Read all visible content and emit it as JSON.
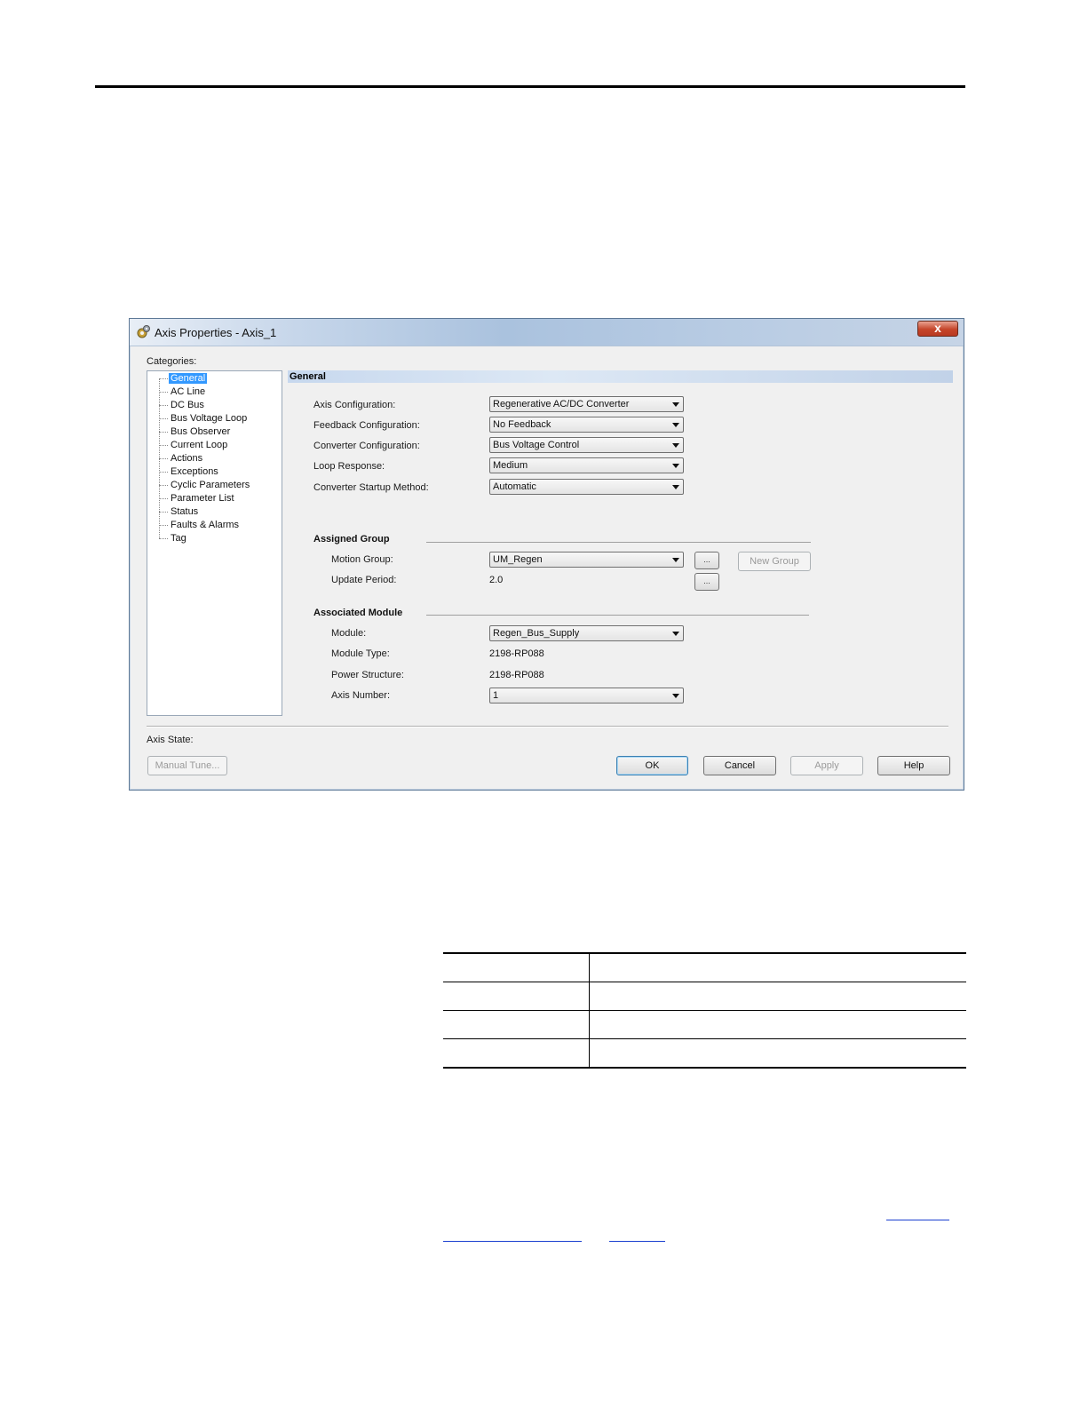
{
  "window": {
    "title": "Axis Properties - Axis_1",
    "close_label": "x"
  },
  "categories": {
    "label": "Categories:",
    "items": [
      {
        "label": "General",
        "selected": true
      },
      {
        "label": "AC Line"
      },
      {
        "label": "DC Bus"
      },
      {
        "label": "Bus Voltage Loop"
      },
      {
        "label": "Bus Observer"
      },
      {
        "label": "Current Loop"
      },
      {
        "label": "Actions"
      },
      {
        "label": "Exceptions"
      },
      {
        "label": "Cyclic Parameters"
      },
      {
        "label": "Parameter List"
      },
      {
        "label": "Status"
      },
      {
        "label": "Faults & Alarms"
      },
      {
        "label": "Tag"
      }
    ]
  },
  "general": {
    "header": "General",
    "axis_configuration": {
      "label": "Axis Configuration:",
      "value": "Regenerative AC/DC Converter"
    },
    "feedback_configuration": {
      "label": "Feedback Configuration:",
      "value": "No Feedback"
    },
    "converter_configuration": {
      "label": "Converter Configuration:",
      "value": "Bus Voltage Control"
    },
    "loop_response": {
      "label": "Loop Response:",
      "value": "Medium"
    },
    "converter_startup_method": {
      "label": "Converter Startup Method:",
      "value": "Automatic"
    }
  },
  "assigned_group": {
    "title": "Assigned Group",
    "motion_group": {
      "label": "Motion Group:",
      "value": "UM_Regen"
    },
    "update_period": {
      "label": "Update Period:",
      "value": "2.0"
    },
    "browse_label": "...",
    "new_group_label": "New Group"
  },
  "associated_module": {
    "title": "Associated Module",
    "module": {
      "label": "Module:",
      "value": "Regen_Bus_Supply"
    },
    "module_type": {
      "label": "Module Type:",
      "value": "2198-RP088"
    },
    "power_structure": {
      "label": "Power Structure:",
      "value": "2198-RP088"
    },
    "axis_number": {
      "label": "Axis Number:",
      "value": "1"
    }
  },
  "footer": {
    "axis_state_label": "Axis State:",
    "manual_tune_label": "Manual Tune...",
    "ok_label": "OK",
    "cancel_label": "Cancel",
    "apply_label": "Apply",
    "help_label": "Help"
  },
  "colors": {
    "selection": "#3399ff",
    "titlebar": "#aac2de",
    "close_button": "#c5452a"
  }
}
